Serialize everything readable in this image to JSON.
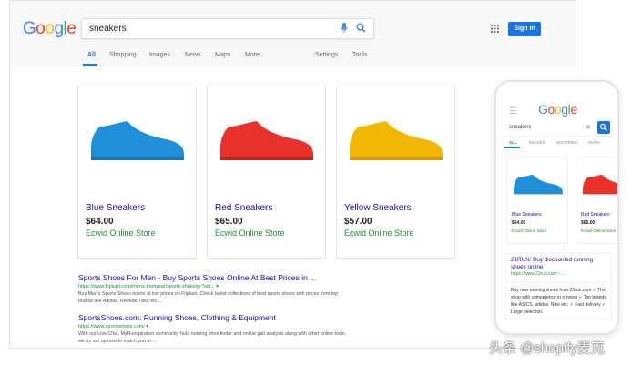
{
  "header": {
    "logo": "Google",
    "query": "sneakers",
    "sign_in": "Sign in"
  },
  "tabs": [
    "All",
    "Shopping",
    "Images",
    "News",
    "Maps",
    "More",
    "Settings",
    "Tools"
  ],
  "products": [
    {
      "name": "Blue Sneakers",
      "price": "$64.00",
      "store": "Ecwid Online Store",
      "color": "#1e8fd8"
    },
    {
      "name": "Red Sneakers",
      "price": "$65.00",
      "store": "Ecwid Online Store",
      "color": "#e8312a"
    },
    {
      "name": "Yellow Sneakers",
      "price": "$57.00",
      "store": "Ecwid Online Store",
      "color": "#f2b705"
    }
  ],
  "results": [
    {
      "title": "Sports Shoes For Men - Buy Sports Shoes Online At Best Prices in ...",
      "url": "https://www.flipkart.com/mens-footwear/sports-shoes/pr?sid... ▾",
      "desc": "Buy Men's Sports Shoes online at low prices on Flipkart. Check latest collections of best sports shoes with prices from top brands like Adidas, Reebok, Nike etc ..."
    },
    {
      "title": "SportsShoes.com: Running Shoes, Clothing & Equipment",
      "url": "https://www.sportsshoes.com/ ▾",
      "desc": "With our Live Chat, MyRunspiration community hub, running shoe finder and online gait analysis along with other online tools, we try our upmost to match you to ..."
    }
  ],
  "mobile": {
    "logo": "Google",
    "query": "sneakers",
    "tabs": [
      "ALL",
      "IMAGES",
      "SHOPPING",
      "MAPS"
    ],
    "products": [
      {
        "name": "Blue Sneakers",
        "price": "$64.00",
        "store": "Ecwid Online Store"
      },
      {
        "name": "Red Sneakers",
        "price": "$65.00",
        "store": "Ecwid Online Store"
      }
    ],
    "result": {
      "title": "21RUN: Buy discounted running shoes online",
      "url": "https://www.21run.com › ...",
      "desc": "Buy new running shoes from 21run.com ✓ The shop with competence in running ✓ Top brands like ASICS, adidas, Nike etc. ✓ Fast delivery ✓ Large selection."
    }
  },
  "watermark": "头条 @shopify麦克"
}
